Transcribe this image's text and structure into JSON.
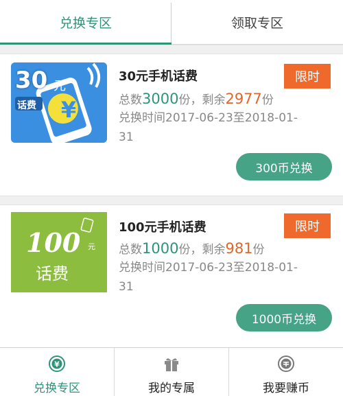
{
  "tabs": [
    {
      "label": "兑换专区",
      "active": true
    },
    {
      "label": "领取专区",
      "active": false
    }
  ],
  "items": [
    {
      "thumb_big": "30",
      "thumb_unit": "元",
      "thumb_small": "话费",
      "title": "30元手机话费",
      "total_prefix": "总数",
      "total": "3000",
      "total_suffix": "份，",
      "remaining_prefix": "剩余",
      "remaining": "2977",
      "remaining_suffix": "份",
      "time_line1": "兑换时间2017-06-23至2018-01-",
      "time_line2": "31",
      "badge": "限时",
      "button": "300币兑换"
    },
    {
      "thumb_big": "100",
      "thumb_unit": "元",
      "thumb_small": "话费",
      "title": "100元手机话费",
      "total_prefix": "总数",
      "total": "1000",
      "total_suffix": "份，",
      "remaining_prefix": "剩余",
      "remaining": "981",
      "remaining_suffix": "份",
      "time_line1": "兑换时间2017-06-23至2018-01-",
      "time_line2": "31",
      "badge": "限时",
      "button": "1000币兑换"
    }
  ],
  "bottom_nav": [
    {
      "label": "兑换专区",
      "icon": "yen-coin-icon",
      "active": true
    },
    {
      "label": "我的专属",
      "icon": "gift-icon",
      "active": false
    },
    {
      "label": "我要赚币",
      "icon": "coin-icon",
      "active": false
    }
  ],
  "colors": {
    "accent": "#2e9477",
    "badge": "#f0692c",
    "remaining": "#e2662b",
    "button": "#46a386"
  }
}
